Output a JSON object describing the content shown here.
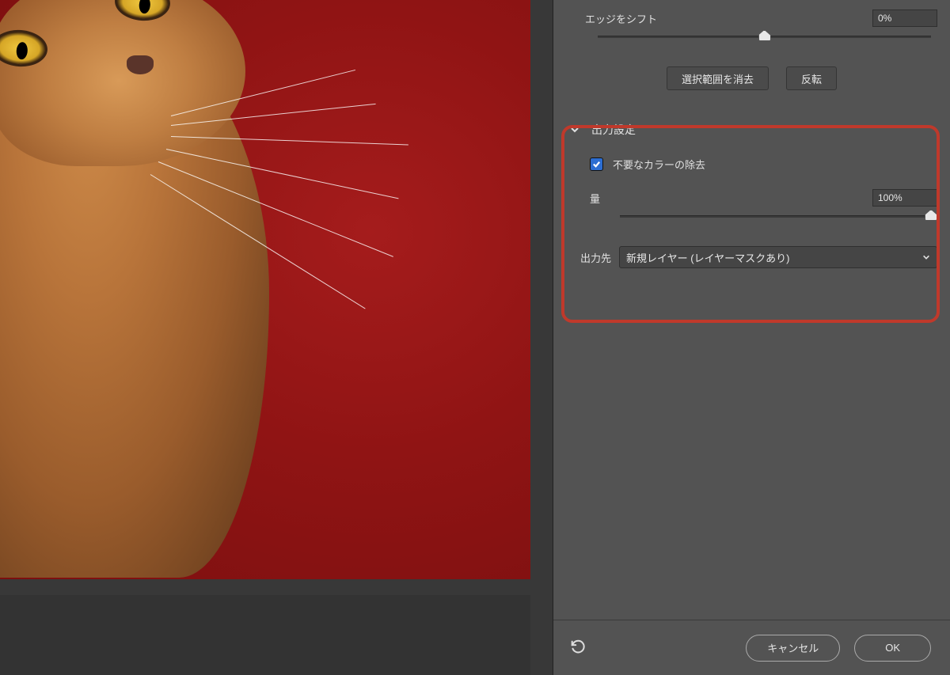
{
  "edgeShift": {
    "label": "エッジをシフト",
    "value": "0%",
    "sliderPos": 50
  },
  "buttons": {
    "clearSelection": "選択範囲を消去",
    "invert": "反転"
  },
  "output": {
    "title": "出力設定",
    "removeColorLabel": "不要なカラーの除去",
    "removeColorChecked": true,
    "amountLabel": "量",
    "amountValue": "100%",
    "amountSliderPos": 100,
    "destLabel": "出力先",
    "destValue": "新規レイヤー (レイヤーマスクあり)"
  },
  "footer": {
    "cancel": "キャンセル",
    "ok": "OK"
  }
}
